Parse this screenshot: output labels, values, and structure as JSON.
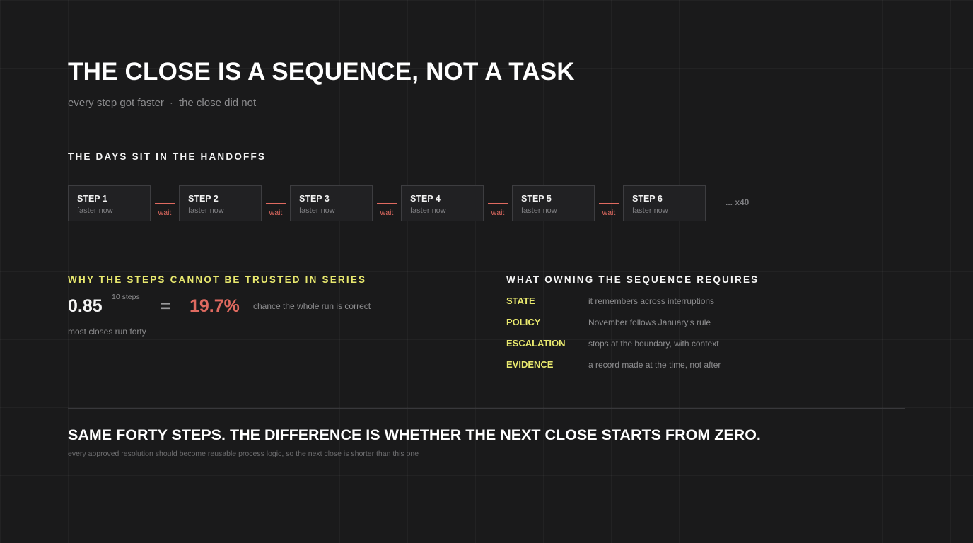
{
  "header": {
    "title": "THE CLOSE IS A SEQUENCE, NOT A TASK",
    "subtitle_left": "every step got faster",
    "subtitle_separator": "·",
    "subtitle_right": "the close did not"
  },
  "handoffs": {
    "label": "THE DAYS SIT IN THE HANDOFFS",
    "steps": [
      {
        "title": "STEP 1",
        "sub": "faster now"
      },
      {
        "title": "STEP 2",
        "sub": "faster now"
      },
      {
        "title": "STEP 3",
        "sub": "faster now"
      },
      {
        "title": "STEP 4",
        "sub": "faster now"
      },
      {
        "title": "STEP 5",
        "sub": "faster now"
      },
      {
        "title": "STEP 6",
        "sub": "faster now"
      }
    ],
    "connector_label": "wait",
    "more": "... x40"
  },
  "series": {
    "label": "WHY THE STEPS CANNOT BE TRUSTED IN SERIES",
    "base": "0.85",
    "exponent_note": "10 steps",
    "equals": "=",
    "result": "19.7%",
    "result_desc": "chance the whole run is correct",
    "footnote": "most closes run forty"
  },
  "requirements": {
    "label": "WHAT OWNING THE SEQUENCE REQUIRES",
    "items": [
      {
        "term": "STATE",
        "desc": "it remembers across interruptions"
      },
      {
        "term": "POLICY",
        "desc": "November follows January's rule"
      },
      {
        "term": "ESCALATION",
        "desc": "stops at the boundary, with context"
      },
      {
        "term": "EVIDENCE",
        "desc": "a record made at the time, not after"
      }
    ]
  },
  "conclusion": {
    "headline": "SAME FORTY STEPS. THE DIFFERENCE IS WHETHER THE NEXT CLOSE STARTS FROM ZERO.",
    "sub": "every approved resolution should become reusable process logic, so the next close is shorter than this one"
  },
  "colors": {
    "background": "#1a1a1b",
    "accent_yellow": "#e8e86e",
    "accent_red": "#e06a60"
  }
}
